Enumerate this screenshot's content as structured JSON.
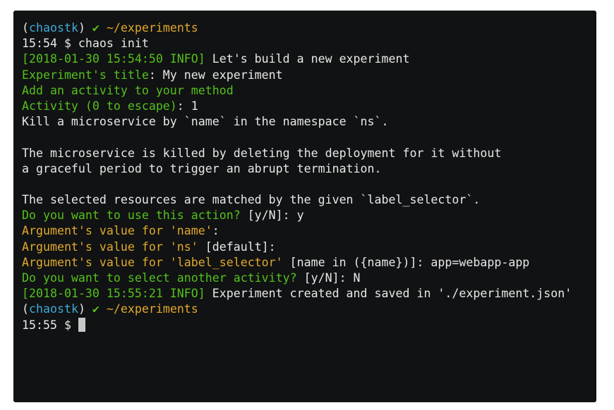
{
  "terminal": {
    "lines": [
      {
        "spans": [
          {
            "t": "(",
            "c": "c-white"
          },
          {
            "t": "chaostk",
            "c": "c-blue"
          },
          {
            "t": ") ",
            "c": "c-white"
          },
          {
            "t": "✔",
            "c": "c-green"
          },
          {
            "t": " ~/experiments",
            "c": "c-yellow"
          }
        ]
      },
      {
        "spans": [
          {
            "t": "15:54 $ chaos init",
            "c": "c-white"
          }
        ]
      },
      {
        "spans": [
          {
            "t": "[2018-01-30 15:54:50 INFO]",
            "c": "c-green"
          },
          {
            "t": " Let's build a new experiment",
            "c": "c-white"
          }
        ]
      },
      {
        "spans": [
          {
            "t": "Experiment's title",
            "c": "c-green"
          },
          {
            "t": ": My new experiment",
            "c": "c-white"
          }
        ]
      },
      {
        "spans": [
          {
            "t": "Add an activity to your method",
            "c": "c-green"
          }
        ]
      },
      {
        "spans": [
          {
            "t": "Activity (0 to escape)",
            "c": "c-green"
          },
          {
            "t": ": 1",
            "c": "c-white"
          }
        ]
      },
      {
        "spans": [
          {
            "t": "Kill a microservice by `name` in the namespace `ns`.",
            "c": "c-white"
          }
        ]
      },
      {
        "spans": [
          {
            "t": "",
            "c": "c-white"
          }
        ]
      },
      {
        "spans": [
          {
            "t": "The microservice is killed by deleting the deployment for it without",
            "c": "c-white"
          }
        ]
      },
      {
        "spans": [
          {
            "t": "a graceful period to trigger an abrupt termination.",
            "c": "c-white"
          }
        ]
      },
      {
        "spans": [
          {
            "t": "",
            "c": "c-white"
          }
        ]
      },
      {
        "spans": [
          {
            "t": "The selected resources are matched by the given `label_selector`.",
            "c": "c-white"
          }
        ]
      },
      {
        "spans": [
          {
            "t": "Do you want to use this action?",
            "c": "c-green"
          },
          {
            "t": " [y/N]: y",
            "c": "c-white"
          }
        ]
      },
      {
        "spans": [
          {
            "t": "Argument's value for 'name'",
            "c": "c-yellow"
          },
          {
            "t": ":",
            "c": "c-white"
          }
        ]
      },
      {
        "spans": [
          {
            "t": "Argument's value for 'ns'",
            "c": "c-yellow"
          },
          {
            "t": " [default]:",
            "c": "c-white"
          }
        ]
      },
      {
        "spans": [
          {
            "t": "Argument's value for 'label_selector'",
            "c": "c-yellow"
          },
          {
            "t": " [name in ({name})]: app=webapp-app",
            "c": "c-white"
          }
        ]
      },
      {
        "spans": [
          {
            "t": "Do you want to select another activity?",
            "c": "c-green"
          },
          {
            "t": " [y/N]: N",
            "c": "c-white"
          }
        ]
      },
      {
        "spans": [
          {
            "t": "[2018-01-30 15:55:21 INFO]",
            "c": "c-green"
          },
          {
            "t": " Experiment created and saved in './experiment.json'",
            "c": "c-white"
          }
        ]
      },
      {
        "spans": [
          {
            "t": "(",
            "c": "c-white"
          },
          {
            "t": "chaostk",
            "c": "c-blue"
          },
          {
            "t": ") ",
            "c": "c-white"
          },
          {
            "t": "✔",
            "c": "c-green"
          },
          {
            "t": " ~/experiments",
            "c": "c-yellow"
          }
        ]
      },
      {
        "spans": [
          {
            "t": "15:55 $ ",
            "c": "c-white"
          }
        ],
        "cursor": true
      }
    ]
  },
  "colors": {
    "background": "#111213",
    "text": "#e8e8e8",
    "green": "#54c11c",
    "yellow": "#e0a92c",
    "blue": "#3fa9d8"
  }
}
